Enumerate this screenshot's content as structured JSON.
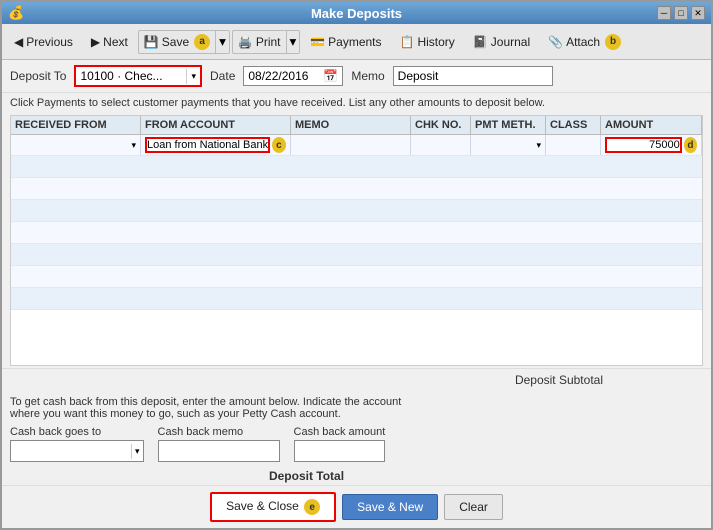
{
  "window": {
    "title": "Make Deposits",
    "icon": "💰"
  },
  "toolbar": {
    "previous_label": "Previous",
    "next_label": "Next",
    "save_label": "Save",
    "print_label": "Print",
    "payments_label": "Payments",
    "history_label": "History",
    "journal_label": "Journal",
    "attach_label": "Attach"
  },
  "form": {
    "deposit_to_label": "Deposit To",
    "deposit_to_value": "10100 · Chec...",
    "date_label": "Date",
    "date_value": "08/22/2016",
    "memo_label": "Memo",
    "memo_value": "Deposit",
    "instructions": "Click Payments to select customer payments that you have received. List any other amounts to deposit below."
  },
  "table": {
    "headers": {
      "received_from": "RECEIVED FROM",
      "from_account": "FROM ACCOUNT",
      "memo": "MEMO",
      "chk_no": "CHK NO.",
      "pmt_meth": "PMT METH.",
      "class": "CLASS",
      "amount": "AMOUNT"
    },
    "rows": [
      {
        "received_from": "",
        "from_account": "Loan from National Bank",
        "memo": "",
        "chk_no": "",
        "pmt_meth": "",
        "class": "",
        "amount": "75000"
      }
    ]
  },
  "subtotal": {
    "label": "Deposit Subtotal"
  },
  "cash_back": {
    "instructions_line1": "To get cash back from this deposit, enter the amount below.  Indicate the account",
    "instructions_line2": "where you want this money to go, such as your Petty Cash account.",
    "goes_to_label": "Cash back goes to",
    "memo_label": "Cash back memo",
    "amount_label": "Cash back amount"
  },
  "deposit_total": {
    "label": "Deposit Total"
  },
  "actions": {
    "save_close_label": "Save & Close",
    "save_new_label": "Save & New",
    "clear_label": "Clear"
  },
  "annotations": {
    "a": "a",
    "b": "b",
    "c": "c",
    "d": "d",
    "e": "e"
  }
}
